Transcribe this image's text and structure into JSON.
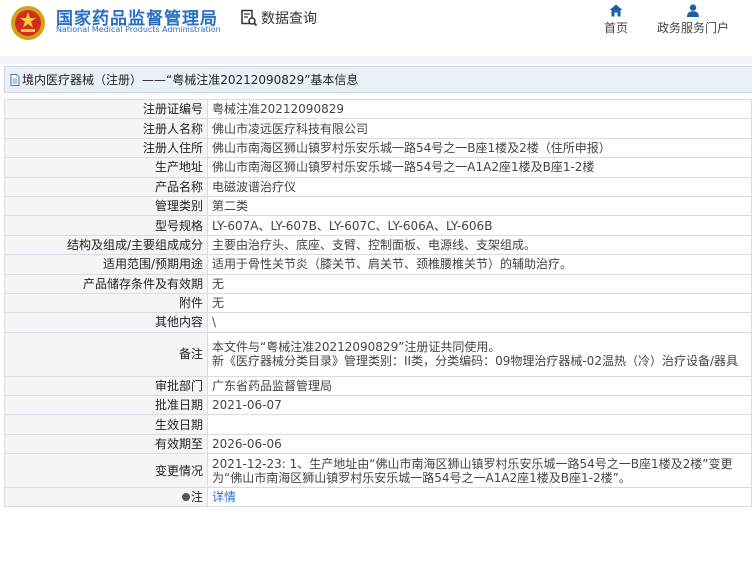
{
  "header": {
    "brand_cn": "国家药品监督管理局",
    "brand_en": "National Medical Products Administration",
    "query_label": "数据查询",
    "nav_home": "首页",
    "nav_service": "政务服务门户"
  },
  "title": "境内医疗器械（注册）——“粤械注准20212090829”基本信息",
  "rows": [
    {
      "label": "注册证编号",
      "value": "粤械注准20212090829"
    },
    {
      "label": "注册人名称",
      "value": "佛山市凌远医疗科技有限公司"
    },
    {
      "label": "注册人住所",
      "value": "佛山市南海区狮山镇罗村乐安乐城一路54号之一B座1楼及2楼（住所申报）"
    },
    {
      "label": "生产地址",
      "value": "佛山市南海区狮山镇罗村乐安乐城一路54号之一A1A2座1楼及B座1-2楼"
    },
    {
      "label": "产品名称",
      "value": "电磁波谱治疗仪"
    },
    {
      "label": "管理类别",
      "value": "第二类"
    },
    {
      "label": "型号规格",
      "value": "LY-607A、LY-607B、LY-607C、LY-606A、LY-606B"
    },
    {
      "label": "结构及组成/主要组成成分",
      "value": "主要由治疗头、底座、支臂、控制面板、电源线、支架组成。"
    },
    {
      "label": "适用范围/预期用途",
      "value": "适用于骨性关节炎（膝关节、肩关节、颈椎腰椎关节）的辅助治疗。"
    },
    {
      "label": "产品储存条件及有效期",
      "value": "无"
    },
    {
      "label": "附件",
      "value": "无"
    },
    {
      "label": "其他内容",
      "value": "\\"
    },
    {
      "label": "备注",
      "value": "本文件与“粤械注准20212090829”注册证共同使用。\n新《医疗器械分类目录》管理类别：II类，分类编码：09物理治疗器械-02温热（冷）治疗设备/器具"
    },
    {
      "label": "审批部门",
      "value": "广东省药品监督管理局"
    },
    {
      "label": "批准日期",
      "value": "2021-06-07"
    },
    {
      "label": "生效日期",
      "value": ""
    },
    {
      "label": "有效期至",
      "value": "2026-06-06"
    },
    {
      "label": "变更情况",
      "value": "2021-12-23: 1、生产地址由“佛山市南海区狮山镇罗村乐安乐城一路54号之一B座1楼及2楼”变更为“佛山市南海区狮山镇罗村乐安乐城一路54号之一A1A2座1楼及B座1-2楼”。"
    }
  ],
  "note": {
    "label": "注",
    "link": "详情"
  }
}
